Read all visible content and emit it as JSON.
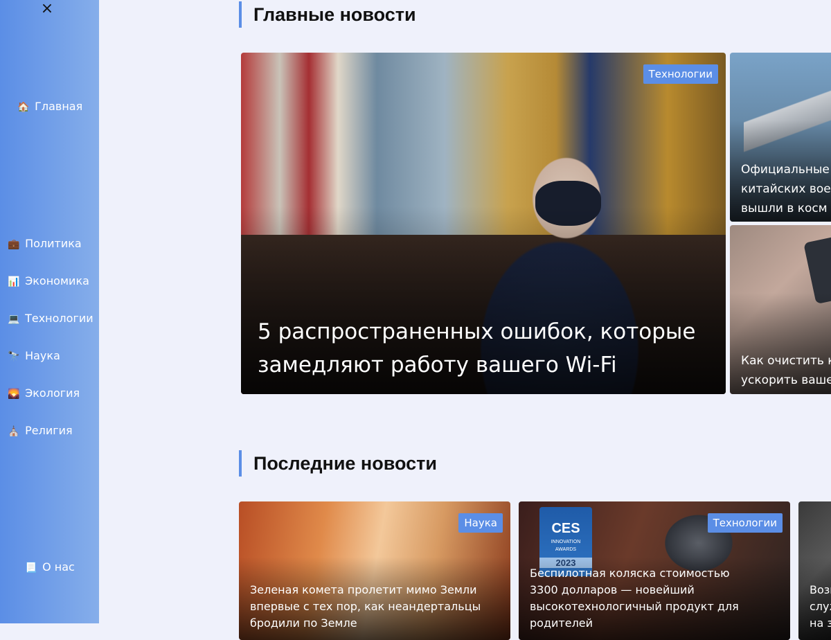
{
  "sidebar": {
    "close_label": "×",
    "home": {
      "icon": "🏠",
      "label": "Главная"
    },
    "categories": [
      {
        "icon": "💼",
        "label": "Политика"
      },
      {
        "icon": "📊",
        "label": "Экономика"
      },
      {
        "icon": "💻",
        "label": "Технологии"
      },
      {
        "icon": "🔭",
        "label": "Наука"
      },
      {
        "icon": "🌄",
        "label": "Экология"
      },
      {
        "icon": "⛪",
        "label": "Религия"
      }
    ],
    "about": {
      "icon": "📃",
      "label": "О нас"
    }
  },
  "main_news": {
    "title": "Главные новости",
    "hero": {
      "badge": "Технологии",
      "title": "5 распространенных ошибок, которые замедляют работу вашего Wi-Fi"
    },
    "side": [
      {
        "title_lines": [
          "Официальные",
          "китайских вое",
          "вышли в косм"
        ]
      },
      {
        "title_lines": [
          "Как очистить к",
          "ускорить ваше"
        ]
      }
    ]
  },
  "latest_news": {
    "title": "Последние новости",
    "cards": [
      {
        "badge": "Наука",
        "title": "Зеленая комета пролетит мимо Земли впервые с тех пор, как неандертальцы бродили по Земле"
      },
      {
        "badge": "Технологии",
        "title": "Беспилотная коляска стоимостью 3300 долларов — новейший высокотехнологичный продукт для родителей",
        "logo": {
          "brand": "CES",
          "line1": "INNOVATION",
          "line2": "AWARDS",
          "year": "2023"
        }
      },
      {
        "title_lines": [
          "Возв",
          "служ",
          "на з"
        ]
      }
    ]
  }
}
